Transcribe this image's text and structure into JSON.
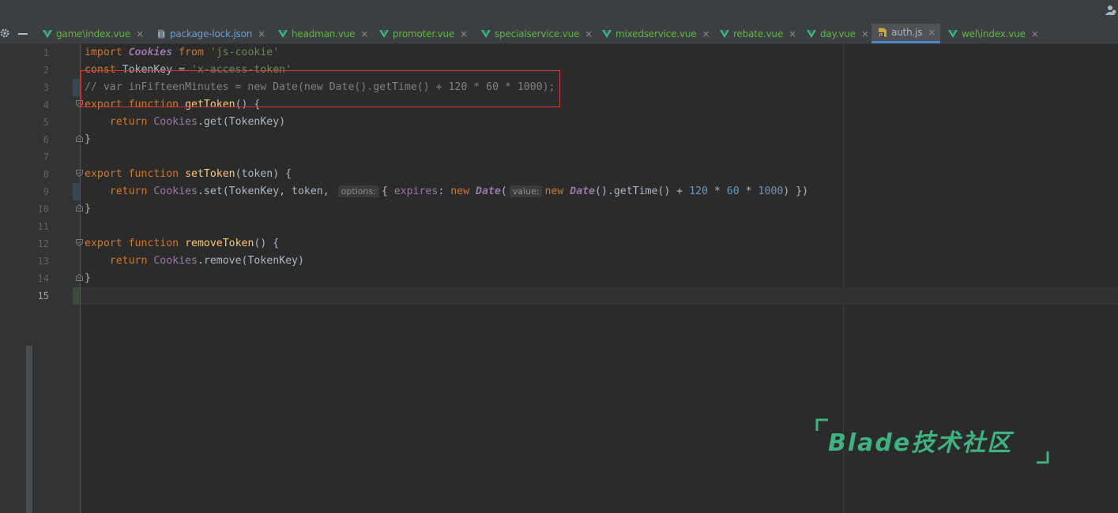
{
  "tabs": [
    {
      "name": "game\\index.vue",
      "type": "vue",
      "close": "×"
    },
    {
      "name": "package-lock.json",
      "type": "json",
      "close": "×"
    },
    {
      "name": "headman.vue",
      "type": "vue",
      "close": "×"
    },
    {
      "name": "promoter.vue",
      "type": "vue",
      "close": "×"
    },
    {
      "name": "specialservice.vue",
      "type": "vue",
      "close": "×"
    },
    {
      "name": "mixedservice.vue",
      "type": "vue",
      "close": "×"
    },
    {
      "name": "rebate.vue",
      "type": "vue",
      "close": "×"
    },
    {
      "name": "day.vue",
      "type": "vue",
      "close": "×"
    },
    {
      "name": "auth.js",
      "type": "js",
      "close": "×",
      "active": true
    },
    {
      "name": "wel\\index.vue",
      "type": "vue",
      "close": "×"
    }
  ],
  "line_numbers": [
    "1",
    "2",
    "3",
    "4",
    "5",
    "6",
    "7",
    "8",
    "9",
    "10",
    "11",
    "12",
    "13",
    "14",
    "15"
  ],
  "current_line": "15",
  "code": {
    "l1": {
      "import": "import",
      "cookies": "Cookies",
      "from": "from",
      "module": "'js-cookie'"
    },
    "l2": {
      "const": "const",
      "rest": " TokenKey = ",
      "value": "'x-access-token'"
    },
    "l3": {
      "comment": "// var inFifteenMinutes = new Date(new Date().getTime() + 120 * 60 * 1000);"
    },
    "l4": {
      "export": "export",
      "function": "function",
      "name": "getToken",
      "rest": "() {"
    },
    "l5": {
      "return": "return",
      "cookies": "Cookies",
      "call": ".get(TokenKey)"
    },
    "l6": {
      "brace": "}"
    },
    "l8": {
      "export": "export",
      "function": "function",
      "name": "setToken",
      "rest": "(token) {"
    },
    "l9": {
      "return": "return",
      "cookies": "Cookies",
      "call": ".set(TokenKey, token, ",
      "hint_options": "options:",
      "obj_open": "{ ",
      "prop": "expires",
      ":": ":",
      "new1": "new",
      "date1": "Date",
      "paren1": "(",
      "hint_value": "value:",
      "new2": "new",
      "date2": "Date",
      "method": "().getTime()",
      "plus": " + ",
      "n1": "120",
      "mul1": " * ",
      "n2": "60",
      "mul2": " * ",
      "n3": "1000",
      "tail": ") })"
    },
    "l10": {
      "brace": "}"
    },
    "l12": {
      "export": "export",
      "function": "function",
      "name": "removeToken",
      "rest": "() {"
    },
    "l13": {
      "return": "return",
      "cookies": "Cookies",
      "call": ".remove(TokenKey)"
    },
    "l14": {
      "brace": "}"
    }
  },
  "watermark": {
    "text": "Blade技术社区"
  },
  "colors": {
    "keyword": "#cc7832",
    "function": "#ffc66d",
    "string": "#6a8759",
    "comment": "#808080",
    "number": "#6897bb",
    "accent": "#4a88c7",
    "highlight_border": "#d23b3b",
    "watermark": "#3fb37f"
  },
  "icons": {
    "vue": "vue-icon",
    "json": "json-file-icon",
    "js": "js-file-icon",
    "settings": "gear-icon",
    "hide": "minus-icon",
    "user": "user-icon"
  }
}
